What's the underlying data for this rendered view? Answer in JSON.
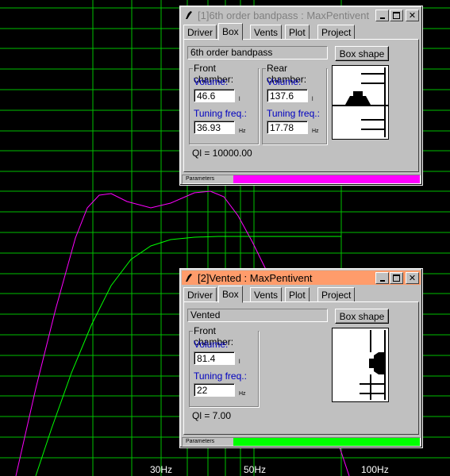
{
  "plot": {
    "x_tick_labels": [
      "30Hz",
      "50Hz",
      "100Hz"
    ],
    "grid_color": "#00c000",
    "curve_colors": [
      "#ff00ff",
      "#00ff00"
    ]
  },
  "window1": {
    "title": "[1]6th order bandpass : MaxPentivent",
    "tabs": [
      "Driver",
      "Box",
      "Vents",
      "Plot",
      "Project"
    ],
    "active_tab": "Box",
    "box_type": "6th order bandpass",
    "box_shape_label": "Box shape",
    "front_chamber": {
      "title": "Front chamber:",
      "volume_label": "Volume:",
      "volume": "46.6",
      "volume_unit": "l",
      "tuning_label": "Tuning freq.:",
      "tuning": "36.93",
      "tuning_unit": "Hz"
    },
    "rear_chamber": {
      "title": "Rear chamber:",
      "volume_label": "Volume:",
      "volume": "137.6",
      "volume_unit": "l",
      "tuning_label": "Tuning freq.:",
      "tuning": "17.78",
      "tuning_unit": "Hz"
    },
    "ql": "Ql = 10000.00",
    "status_label": "Parameters",
    "status_color": "#ff00ff",
    "title_bg": "#c0c0c0",
    "title_color": "#808080"
  },
  "window2": {
    "title": "[2]Vented : MaxPentivent",
    "tabs": [
      "Driver",
      "Box",
      "Vents",
      "Plot",
      "Project"
    ],
    "active_tab": "Box",
    "box_type": "Vented",
    "box_shape_label": "Box shape",
    "front_chamber": {
      "title": "Front chamber:",
      "volume_label": "Volume:",
      "volume": "81.4",
      "volume_unit": "l",
      "tuning_label": "Tuning freq.:",
      "tuning": "22",
      "tuning_unit": "Hz"
    },
    "ql": "Ql = 7.00",
    "status_label": "Parameters",
    "status_color": "#00ff00",
    "title_bg": "#ff9c6b",
    "title_color": "#000000"
  },
  "icons": {
    "app": "speaker-icon",
    "minimize": "minimize-icon",
    "maximize": "maximize-icon",
    "close": "close-icon"
  }
}
